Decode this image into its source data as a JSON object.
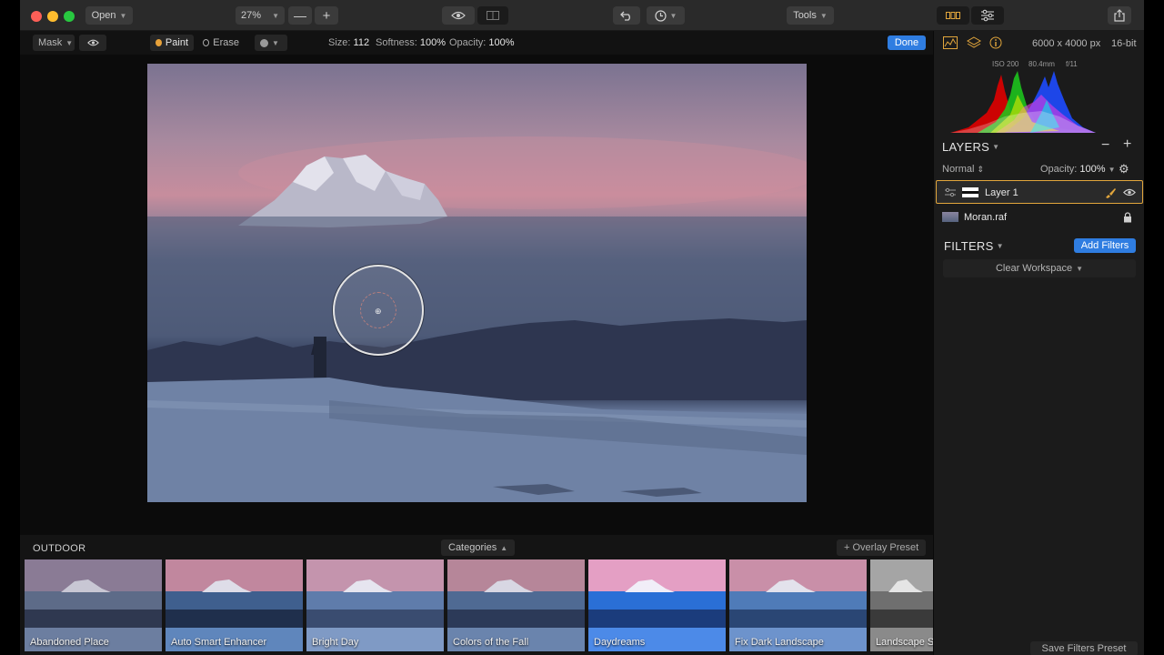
{
  "toolbar": {
    "open_label": "Open",
    "zoom_value": "27%",
    "tools_label": "Tools"
  },
  "mask_bar": {
    "mask_label": "Mask",
    "paint_label": "Paint",
    "erase_label": "Erase",
    "size_label": "Size:",
    "size_value": "112",
    "softness_label": "Softness:",
    "softness_value": "100%",
    "opacity_label": "Opacity:",
    "opacity_value": "100%",
    "done_label": "Done"
  },
  "image_info": {
    "dimensions": "6000 x 4000 px",
    "bit_depth": "16-bit",
    "iso": "ISO 200",
    "focal_length": "80.4mm",
    "aperture": "f/11"
  },
  "layers": {
    "title": "LAYERS",
    "blend_mode": "Normal",
    "opacity_label": "Opacity:",
    "opacity_value": "100%",
    "items": [
      {
        "name": "Layer 1",
        "selected": true
      },
      {
        "name": "Moran.raf",
        "locked": true
      }
    ]
  },
  "filters": {
    "title": "FILTERS",
    "add_label": "Add Filters",
    "workspace_label": "Clear Workspace"
  },
  "presets": {
    "section_label": "OUTDOOR",
    "categories_label": "Categories",
    "overlay_label": "+ Overlay Preset",
    "save_label": "Save Filters Preset",
    "items": [
      "Abandoned Place",
      "Auto Smart Enhancer",
      "Bright Day",
      "Colors of the Fall",
      "Daydreams",
      "Fix Dark Landscape",
      "Landscape So"
    ]
  },
  "colors": {
    "accent_blue": "#2f7de1",
    "selection_orange": "#e2a63c",
    "paint_dot": "#e8a23a"
  }
}
